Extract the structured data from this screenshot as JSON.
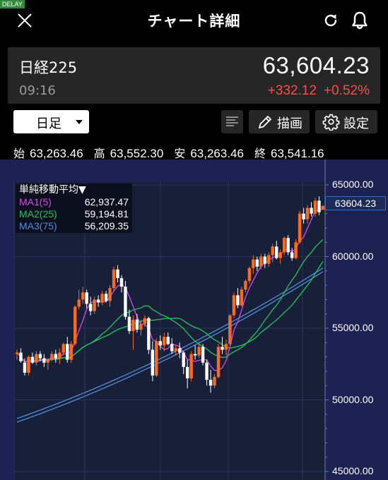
{
  "badge": "DELAY",
  "header": {
    "title": "チャート詳細"
  },
  "quote": {
    "name": "日経225",
    "time": "09:16",
    "price": "63,604.23",
    "change": "+332.12",
    "change_pct": "+0.52%",
    "change_color": "#ff4b4b"
  },
  "toolbar": {
    "period": "日足",
    "draw_label": "描画",
    "settings_label": "設定"
  },
  "ohlc": {
    "open_label": "始",
    "open": "63,263.46",
    "high_label": "高",
    "high": "63,552.30",
    "low_label": "安",
    "low": "63,263.46",
    "close_label": "終",
    "close": "63,541.16"
  },
  "legend": {
    "title": "単純移動平均▼",
    "ma1_label": "MA1(5)",
    "ma1_value": "62,937.47",
    "ma2_label": "MA2(25)",
    "ma2_value": "59,194.81",
    "ma3_label": "MA3(75)",
    "ma3_value": "56,209.35"
  },
  "current_price_tag": "63604.23",
  "chart_data": {
    "type": "candlestick",
    "y_ticks": [
      "65000.00",
      "60000.00",
      "55000.00",
      "50000.00",
      "45000.00"
    ],
    "ylim": [
      45000,
      65000
    ],
    "colors": {
      "up": "#ff6a1a",
      "down": "#ffffff",
      "ma1": "#d946ef",
      "ma2": "#22c55e",
      "ma3": "#4f8fdc",
      "background": "#1d2252"
    },
    "candles": [
      [
        53200,
        53500,
        52800,
        53300
      ],
      [
        53300,
        53600,
        52600,
        52700
      ],
      [
        52600,
        52900,
        51700,
        51900
      ],
      [
        51900,
        53100,
        51700,
        53000
      ],
      [
        53000,
        53300,
        52500,
        52600
      ],
      [
        52600,
        53400,
        52400,
        53200
      ],
      [
        53200,
        53400,
        52700,
        52900
      ],
      [
        52900,
        53200,
        52300,
        52600
      ],
      [
        52600,
        52900,
        52100,
        52800
      ],
      [
        52800,
        53400,
        52700,
        53200
      ],
      [
        53200,
        53500,
        52600,
        52900
      ],
      [
        52900,
        53600,
        52500,
        53300
      ],
      [
        53300,
        54000,
        53100,
        53900
      ],
      [
        53900,
        54400,
        52600,
        52800
      ],
      [
        52800,
        54100,
        52600,
        53900
      ],
      [
        53900,
        56600,
        53800,
        56500
      ],
      [
        56500,
        57700,
        56300,
        57000
      ],
      [
        57000,
        57900,
        56700,
        57500
      ],
      [
        57500,
        57700,
        56400,
        56700
      ],
      [
        56700,
        57200,
        55900,
        56200
      ],
      [
        56200,
        57200,
        56000,
        57000
      ],
      [
        57000,
        57300,
        56500,
        56800
      ],
      [
        56800,
        57600,
        56600,
        57400
      ],
      [
        57400,
        57600,
        56800,
        56900
      ],
      [
        56900,
        58000,
        56500,
        57800
      ],
      [
        57800,
        59300,
        57600,
        59100
      ],
      [
        59100,
        59400,
        58200,
        58500
      ],
      [
        58500,
        58700,
        57500,
        57900
      ],
      [
        57900,
        58300,
        55600,
        55800
      ],
      [
        55800,
        56300,
        54600,
        54800
      ],
      [
        54800,
        55900,
        53500,
        55600
      ],
      [
        55600,
        56000,
        54700,
        54900
      ],
      [
        54900,
        55600,
        54500,
        55300
      ],
      [
        55300,
        55900,
        55100,
        55700
      ],
      [
        55700,
        55800,
        53200,
        53500
      ],
      [
        53500,
        54100,
        51300,
        51700
      ],
      [
        51700,
        54300,
        51600,
        54100
      ],
      [
        54100,
        54500,
        53500,
        53800
      ],
      [
        53800,
        54700,
        53400,
        54400
      ],
      [
        54400,
        54700,
        53800,
        53900
      ],
      [
        53900,
        54300,
        53200,
        53400
      ],
      [
        53400,
        53800,
        53100,
        53600
      ],
      [
        53600,
        54000,
        52900,
        53300
      ],
      [
        53300,
        53400,
        51800,
        52300
      ],
      [
        52300,
        52800,
        50800,
        51500
      ],
      [
        51500,
        53400,
        51300,
        53200
      ],
      [
        53200,
        53800,
        52800,
        53100
      ],
      [
        53100,
        54100,
        52900,
        53700
      ],
      [
        53700,
        53900,
        52400,
        52600
      ],
      [
        52600,
        52800,
        51000,
        51400
      ],
      [
        51400,
        52100,
        50500,
        51000
      ],
      [
        51000,
        51800,
        50800,
        51600
      ],
      [
        51600,
        53900,
        51500,
        53700
      ],
      [
        53700,
        54400,
        53200,
        53500
      ],
      [
        53500,
        54200,
        53100,
        53900
      ],
      [
        53900,
        56000,
        53800,
        55900
      ],
      [
        55900,
        57500,
        55700,
        57300
      ],
      [
        57300,
        57800,
        56400,
        56600
      ],
      [
        56600,
        57900,
        56500,
        57700
      ],
      [
        57700,
        58400,
        57500,
        58300
      ],
      [
        58300,
        59300,
        58100,
        59200
      ],
      [
        59200,
        60100,
        58800,
        59800
      ],
      [
        59800,
        60000,
        59000,
        59300
      ],
      [
        59300,
        60200,
        59100,
        60000
      ],
      [
        60000,
        60200,
        59200,
        59500
      ],
      [
        59500,
        60300,
        59300,
        60100
      ],
      [
        60100,
        60900,
        59600,
        60700
      ],
      [
        60700,
        61100,
        59800,
        59900
      ],
      [
        59900,
        60500,
        59500,
        60300
      ],
      [
        60300,
        61400,
        60100,
        61300
      ],
      [
        61300,
        61500,
        60100,
        60300
      ],
      [
        60300,
        60600,
        59700,
        59900
      ],
      [
        59900,
        61200,
        59800,
        61000
      ],
      [
        61000,
        63200,
        60900,
        63000
      ],
      [
        63000,
        63400,
        62300,
        62600
      ],
      [
        62600,
        63600,
        62300,
        63400
      ],
      [
        63400,
        63800,
        62800,
        63000
      ],
      [
        63000,
        64100,
        62800,
        63900
      ],
      [
        63900,
        64200,
        62900,
        63100
      ],
      [
        63263,
        63552,
        63263,
        63541
      ]
    ]
  }
}
